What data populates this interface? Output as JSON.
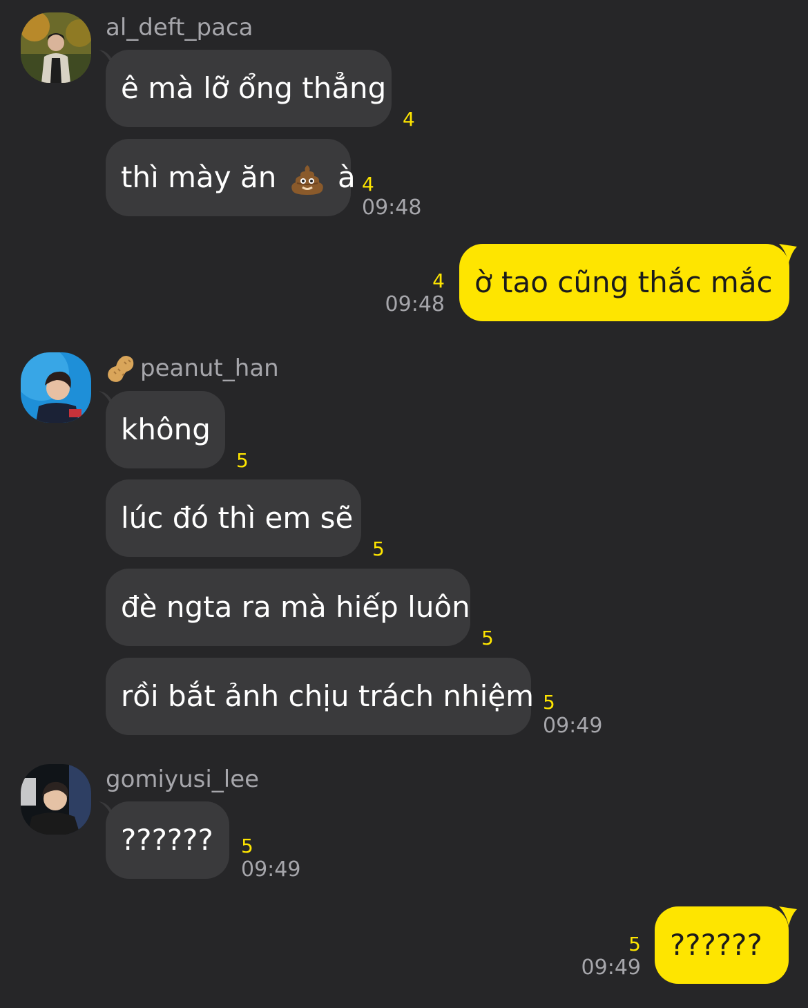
{
  "colors": {
    "background": "#262628",
    "incoming_bubble": "#3a3a3c",
    "outgoing_bubble": "#fee500",
    "unread_count": "#fee500",
    "timestamp": "#a6a6ab"
  },
  "groups": [
    {
      "sender": "al_deft_paca",
      "messages": [
        {
          "text": "ê mà lỡ ổng thẳng",
          "unread": "4"
        },
        {
          "text_before": "thì mày ăn",
          "emoji": "pile-of-poo-icon",
          "text_after": "à",
          "unread": "4",
          "time": "09:48"
        }
      ]
    },
    {
      "outgoing": true,
      "messages": [
        {
          "text": "ờ tao cũng thắc mắc",
          "unread": "4",
          "time": "09:48"
        }
      ]
    },
    {
      "sender_badge": "peanut-icon",
      "sender": "peanut_han",
      "messages": [
        {
          "text": "không",
          "unread": "5"
        },
        {
          "text": "lúc đó thì em sẽ",
          "unread": "5"
        },
        {
          "text": "đè ngta ra mà hiếp luôn",
          "unread": "5"
        },
        {
          "text": "rồi bắt ảnh chịu trách nhiệm",
          "unread": "5",
          "time": "09:49"
        }
      ]
    },
    {
      "sender": "gomiyusi_lee",
      "messages": [
        {
          "text": "??????",
          "unread": "5",
          "time": "09:49"
        }
      ]
    },
    {
      "outgoing": true,
      "messages": [
        {
          "text": "??????",
          "unread": "5",
          "time": "09:49"
        }
      ]
    }
  ]
}
